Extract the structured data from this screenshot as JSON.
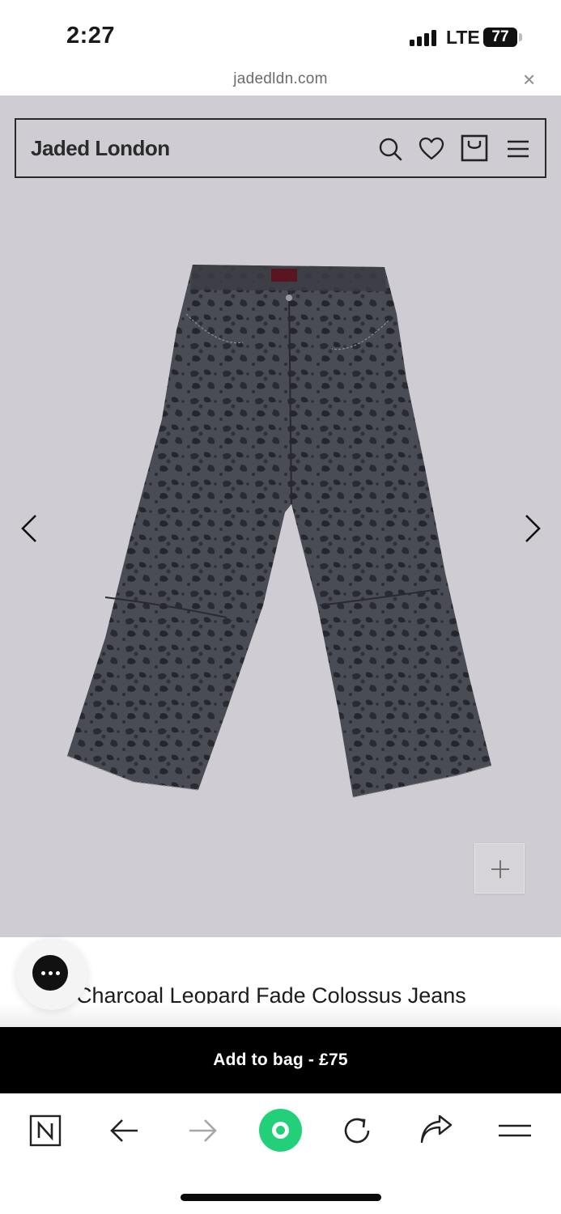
{
  "status_bar": {
    "time": "2:27",
    "network": "LTE",
    "battery": "77"
  },
  "browser": {
    "url": "jadedldn.com",
    "close_glyph": "×"
  },
  "site_header": {
    "brand": "Jaded London",
    "icons": [
      "search-icon",
      "heart-icon",
      "shopping-bag-icon",
      "menu-icon"
    ]
  },
  "product": {
    "image": "charcoal leopard print wide-leg jeans",
    "title": "Charcoal Leopard Fade Colossus Jeans",
    "visible_title": "Charcoal Leopard Fade Colossus Jeans",
    "gallery_prev_icon": "chevron-left-icon",
    "gallery_next_icon": "chevron-right-icon",
    "zoom_icon": "plus-icon"
  },
  "cta": {
    "label": "Add to bag -  £75"
  },
  "toolbar": {
    "icons": [
      "tabs-n-icon",
      "back-icon",
      "forward-icon",
      "home-record-icon",
      "reload-icon",
      "share-icon",
      "menu-icon"
    ]
  },
  "colors": {
    "page_bg": "#cfcdd3",
    "cta_bg": "#000000",
    "accent_green": "#22d07a"
  }
}
